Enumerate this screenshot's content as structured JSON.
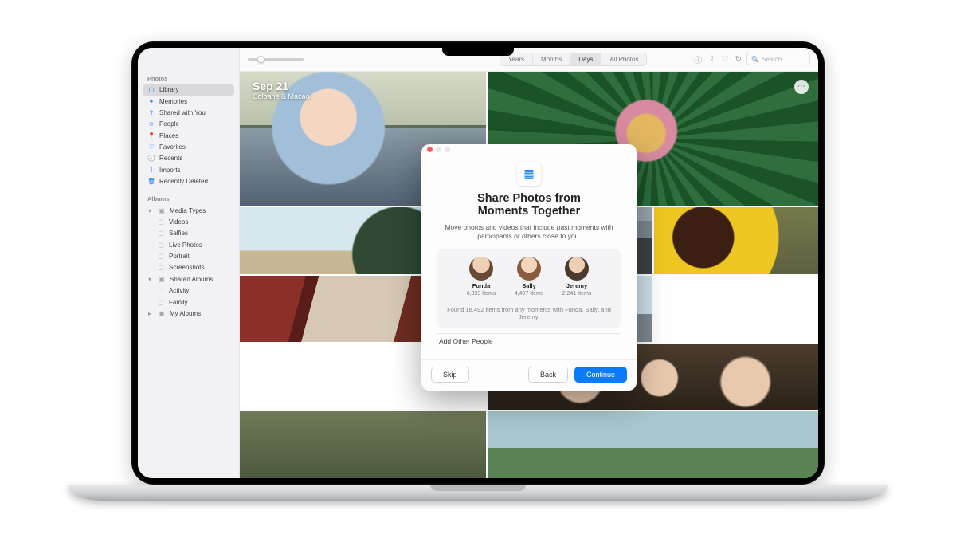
{
  "sidebar": {
    "section1": "Photos",
    "items1": [
      {
        "icon": "▢",
        "label": "Library",
        "selected": true
      },
      {
        "icon": "✦",
        "label": "Memories"
      },
      {
        "icon": "⇪",
        "label": "Shared with You"
      },
      {
        "icon": "☺",
        "label": "People"
      },
      {
        "icon": "📍",
        "label": "Places"
      },
      {
        "icon": "♡",
        "label": "Favorites"
      },
      {
        "icon": "🕘",
        "label": "Recents"
      },
      {
        "icon": "⇩",
        "label": "Imports"
      },
      {
        "icon": "🗑",
        "label": "Recently Deleted"
      }
    ],
    "section2": "Albums",
    "group_media": "Media Types",
    "media_items": [
      {
        "label": "Videos"
      },
      {
        "label": "Selfies"
      },
      {
        "label": "Live Photos"
      },
      {
        "label": "Portrait"
      },
      {
        "label": "Screenshots"
      }
    ],
    "group_shared": "Shared Albums",
    "shared_items": [
      {
        "label": "Activity"
      },
      {
        "label": "Family"
      }
    ],
    "group_my": "My Albums"
  },
  "toolbar": {
    "seg": [
      "Years",
      "Months",
      "Days",
      "All Photos"
    ],
    "seg_active": 2,
    "search_placeholder": "Search"
  },
  "header": {
    "date": "Sep 21",
    "location": "Coloane & Macao"
  },
  "modal": {
    "title_l1": "Share Photos from",
    "title_l2": "Moments Together",
    "subtitle": "Move photos and videos that include past moments with participants or others close to you.",
    "people": [
      {
        "name": "Funda",
        "count": "6,333 Items"
      },
      {
        "name": "Sally",
        "count": "4,497 Items"
      },
      {
        "name": "Jeremy",
        "count": "2,241 Items"
      }
    ],
    "found": "Found 18,492 items from any moments with Funda, Sally, and Jeremy.",
    "add_other": "Add Other People",
    "skip": "Skip",
    "back": "Back",
    "continue": "Continue"
  }
}
